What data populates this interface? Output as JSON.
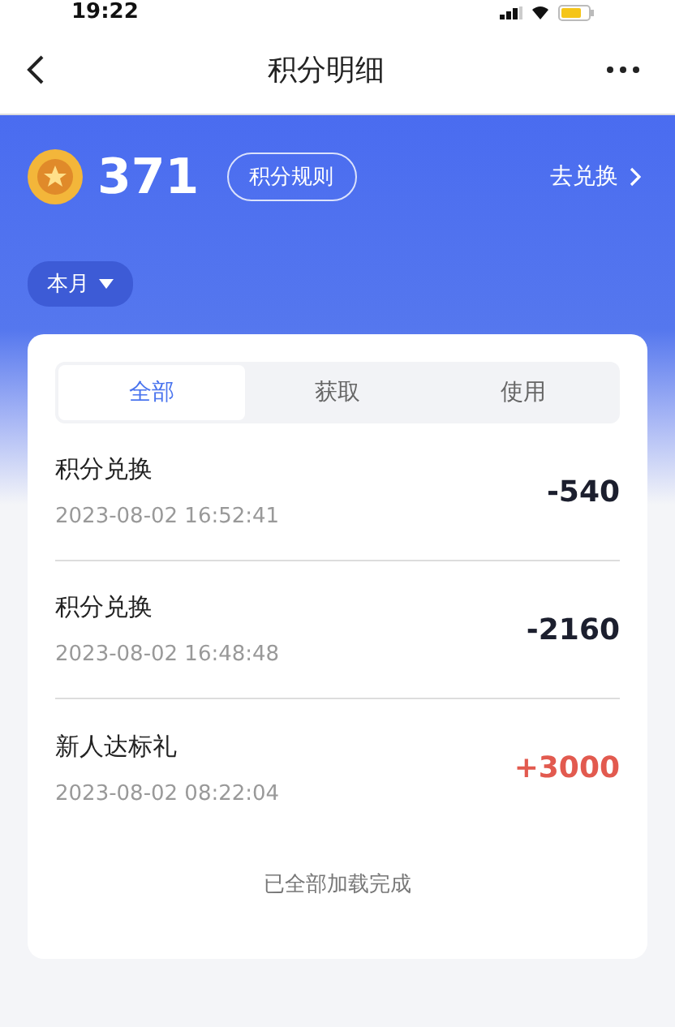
{
  "status_bar": {
    "time": "19:22"
  },
  "nav": {
    "title": "积分明细"
  },
  "summary": {
    "points": "371",
    "rules_button": "积分规则",
    "exchange_link": "去兑换"
  },
  "filter": {
    "label": "本月"
  },
  "tabs": [
    {
      "label": "全部",
      "selected": true
    },
    {
      "label": "获取",
      "selected": false
    },
    {
      "label": "使用",
      "selected": false
    }
  ],
  "records": [
    {
      "title": "积分兑换",
      "time": "2023-08-02 16:52:41",
      "amount": "-540",
      "kind": "expense"
    },
    {
      "title": "积分兑换",
      "time": "2023-08-02 16:48:48",
      "amount": "-2160",
      "kind": "expense"
    },
    {
      "title": "新人达标礼",
      "time": "2023-08-02 08:22:04",
      "amount": "+3000",
      "kind": "income"
    }
  ],
  "footer": "已全部加载完成"
}
